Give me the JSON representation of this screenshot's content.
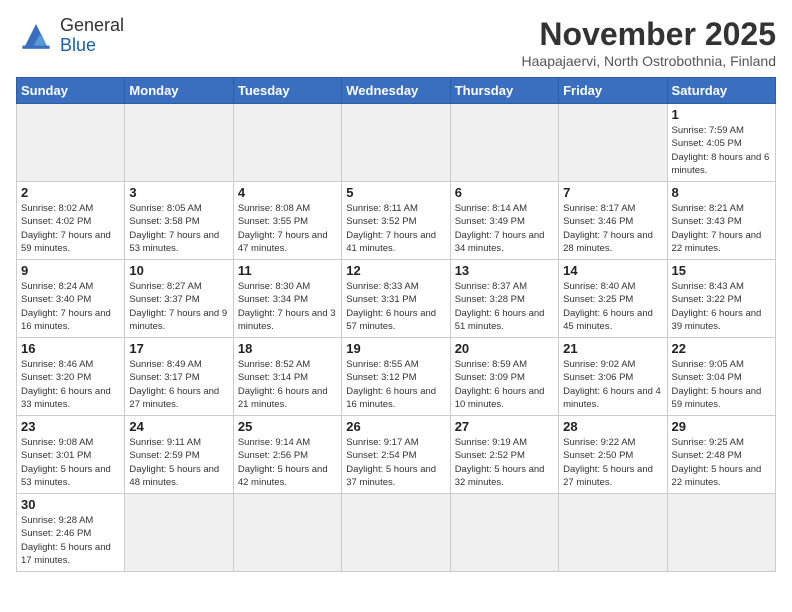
{
  "header": {
    "logo_line1": "General",
    "logo_line2": "Blue",
    "month_title": "November 2025",
    "location": "Haapajaervi, North Ostrobothnia, Finland"
  },
  "weekdays": [
    "Sunday",
    "Monday",
    "Tuesday",
    "Wednesday",
    "Thursday",
    "Friday",
    "Saturday"
  ],
  "weeks": [
    [
      {
        "day": "",
        "info": ""
      },
      {
        "day": "",
        "info": ""
      },
      {
        "day": "",
        "info": ""
      },
      {
        "day": "",
        "info": ""
      },
      {
        "day": "",
        "info": ""
      },
      {
        "day": "",
        "info": ""
      },
      {
        "day": "1",
        "info": "Sunrise: 7:59 AM\nSunset: 4:05 PM\nDaylight: 8 hours\nand 6 minutes."
      }
    ],
    [
      {
        "day": "2",
        "info": "Sunrise: 8:02 AM\nSunset: 4:02 PM\nDaylight: 7 hours\nand 59 minutes."
      },
      {
        "day": "3",
        "info": "Sunrise: 8:05 AM\nSunset: 3:58 PM\nDaylight: 7 hours\nand 53 minutes."
      },
      {
        "day": "4",
        "info": "Sunrise: 8:08 AM\nSunset: 3:55 PM\nDaylight: 7 hours\nand 47 minutes."
      },
      {
        "day": "5",
        "info": "Sunrise: 8:11 AM\nSunset: 3:52 PM\nDaylight: 7 hours\nand 41 minutes."
      },
      {
        "day": "6",
        "info": "Sunrise: 8:14 AM\nSunset: 3:49 PM\nDaylight: 7 hours\nand 34 minutes."
      },
      {
        "day": "7",
        "info": "Sunrise: 8:17 AM\nSunset: 3:46 PM\nDaylight: 7 hours\nand 28 minutes."
      },
      {
        "day": "8",
        "info": "Sunrise: 8:21 AM\nSunset: 3:43 PM\nDaylight: 7 hours\nand 22 minutes."
      }
    ],
    [
      {
        "day": "9",
        "info": "Sunrise: 8:24 AM\nSunset: 3:40 PM\nDaylight: 7 hours\nand 16 minutes."
      },
      {
        "day": "10",
        "info": "Sunrise: 8:27 AM\nSunset: 3:37 PM\nDaylight: 7 hours\nand 9 minutes."
      },
      {
        "day": "11",
        "info": "Sunrise: 8:30 AM\nSunset: 3:34 PM\nDaylight: 7 hours\nand 3 minutes."
      },
      {
        "day": "12",
        "info": "Sunrise: 8:33 AM\nSunset: 3:31 PM\nDaylight: 6 hours\nand 57 minutes."
      },
      {
        "day": "13",
        "info": "Sunrise: 8:37 AM\nSunset: 3:28 PM\nDaylight: 6 hours\nand 51 minutes."
      },
      {
        "day": "14",
        "info": "Sunrise: 8:40 AM\nSunset: 3:25 PM\nDaylight: 6 hours\nand 45 minutes."
      },
      {
        "day": "15",
        "info": "Sunrise: 8:43 AM\nSunset: 3:22 PM\nDaylight: 6 hours\nand 39 minutes."
      }
    ],
    [
      {
        "day": "16",
        "info": "Sunrise: 8:46 AM\nSunset: 3:20 PM\nDaylight: 6 hours\nand 33 minutes."
      },
      {
        "day": "17",
        "info": "Sunrise: 8:49 AM\nSunset: 3:17 PM\nDaylight: 6 hours\nand 27 minutes."
      },
      {
        "day": "18",
        "info": "Sunrise: 8:52 AM\nSunset: 3:14 PM\nDaylight: 6 hours\nand 21 minutes."
      },
      {
        "day": "19",
        "info": "Sunrise: 8:55 AM\nSunset: 3:12 PM\nDaylight: 6 hours\nand 16 minutes."
      },
      {
        "day": "20",
        "info": "Sunrise: 8:59 AM\nSunset: 3:09 PM\nDaylight: 6 hours\nand 10 minutes."
      },
      {
        "day": "21",
        "info": "Sunrise: 9:02 AM\nSunset: 3:06 PM\nDaylight: 6 hours\nand 4 minutes."
      },
      {
        "day": "22",
        "info": "Sunrise: 9:05 AM\nSunset: 3:04 PM\nDaylight: 5 hours\nand 59 minutes."
      }
    ],
    [
      {
        "day": "23",
        "info": "Sunrise: 9:08 AM\nSunset: 3:01 PM\nDaylight: 5 hours\nand 53 minutes."
      },
      {
        "day": "24",
        "info": "Sunrise: 9:11 AM\nSunset: 2:59 PM\nDaylight: 5 hours\nand 48 minutes."
      },
      {
        "day": "25",
        "info": "Sunrise: 9:14 AM\nSunset: 2:56 PM\nDaylight: 5 hours\nand 42 minutes."
      },
      {
        "day": "26",
        "info": "Sunrise: 9:17 AM\nSunset: 2:54 PM\nDaylight: 5 hours\nand 37 minutes."
      },
      {
        "day": "27",
        "info": "Sunrise: 9:19 AM\nSunset: 2:52 PM\nDaylight: 5 hours\nand 32 minutes."
      },
      {
        "day": "28",
        "info": "Sunrise: 9:22 AM\nSunset: 2:50 PM\nDaylight: 5 hours\nand 27 minutes."
      },
      {
        "day": "29",
        "info": "Sunrise: 9:25 AM\nSunset: 2:48 PM\nDaylight: 5 hours\nand 22 minutes."
      }
    ],
    [
      {
        "day": "30",
        "info": "Sunrise: 9:28 AM\nSunset: 2:46 PM\nDaylight: 5 hours\nand 17 minutes."
      },
      {
        "day": "",
        "info": ""
      },
      {
        "day": "",
        "info": ""
      },
      {
        "day": "",
        "info": ""
      },
      {
        "day": "",
        "info": ""
      },
      {
        "day": "",
        "info": ""
      },
      {
        "day": "",
        "info": ""
      }
    ]
  ]
}
